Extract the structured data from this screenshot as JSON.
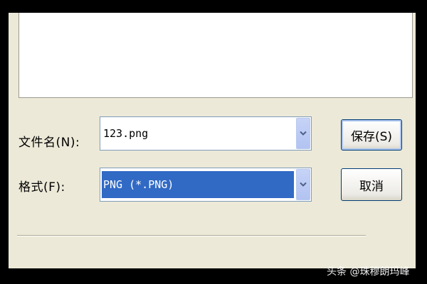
{
  "form": {
    "filename_label": "文件名(N):",
    "filename_value": "123.png",
    "format_label": "格式(F):",
    "format_value": "PNG (*.PNG)"
  },
  "buttons": {
    "save_label": "保存(S)",
    "cancel_label": "取消"
  },
  "icons": {
    "combo_arrow": "chevron-down-icon"
  },
  "colors": {
    "dialog_bg": "#ece9d8",
    "selection_bg": "#316ac5",
    "combo_button": "#b2c3f2",
    "button_border": "#003c74"
  },
  "watermark": "头条 @珠穆朗玛峰"
}
